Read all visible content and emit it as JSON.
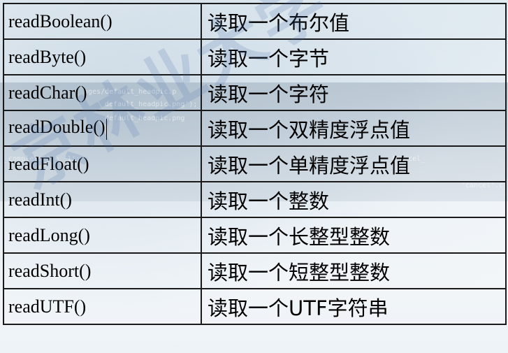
{
  "table": {
    "rows": [
      {
        "method": "readBoolean()",
        "description": "读取一个布尔值"
      },
      {
        "method": "readByte()",
        "description": "读取一个字节"
      },
      {
        "method": "readChar()",
        "description": "读取一个字符"
      },
      {
        "method": "readDouble()",
        "description": "读取一个双精度浮点值"
      },
      {
        "method": "readFloat()",
        "description": "读取一个单精度浮点值"
      },
      {
        "method": "readInt()",
        "description": "读取一个整数"
      },
      {
        "method": "readLong()",
        "description": "读取一个长整型整数"
      },
      {
        "method": "readShort()",
        "description": "读取一个短整型整数"
      },
      {
        "method": "readUTF()",
        "description": "读取一个UTF字符串"
      }
    ]
  },
  "background_code": {
    "lines": [
      "ages/default_headpic.p",
      "default_headpic.png');",
      "default_headpic.png",
      "_complete') = '1';",
      "{cancel_",
      "'cancel'.c"
    ]
  },
  "watermark": {
    "text": "京林业大学《Java程序"
  }
}
